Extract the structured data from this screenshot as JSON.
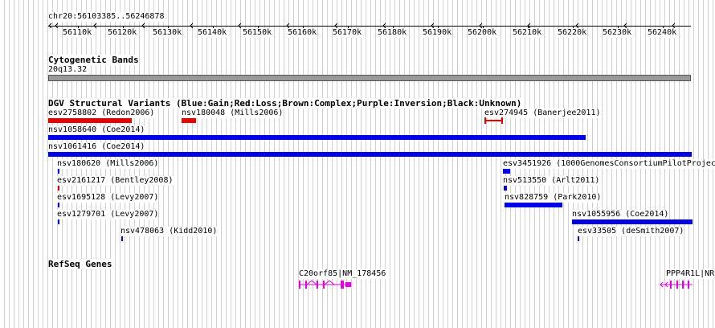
{
  "position": "chr20:56103385..56246878",
  "ruler_ticks": [
    "56110k",
    "56120k",
    "56130k",
    "56140k",
    "56150k",
    "56160k",
    "56170k",
    "56180k",
    "56190k",
    "56200k",
    "56210k",
    "56220k",
    "56230k",
    "56240k"
  ],
  "cyto": {
    "title": "Cytogenetic Bands",
    "band": "20q13.32"
  },
  "dgv": {
    "title": "DGV Structural Variants (Blue:Gain;Red:Loss;Brown:Complex;Purple:Inversion;Black:Unknown)",
    "variants": [
      "esv2758802 (Redon2006)",
      "nsv180048 (Mills2006)",
      "esv274945 (Banerjee2011)",
      "nsv1058640 (Coe2014)",
      "nsv1061416 (Coe2014)",
      "nsv180620 (Mills2006)",
      "esv3451926 (1000GenomesConsortiumPilotProjec",
      "esv2161217 (Bentley2008)",
      "nsv513550 (Arlt2011)",
      "esv1695128 (Levy2007)",
      "nsv828759 (Park2010)",
      "esv1279701 (Levy2007)",
      "nsv1055956 (Coe2014)",
      "nsv478063 (Kidd2010)",
      "esv33505 (deSmith2007)"
    ]
  },
  "refseq": {
    "title": "RefSeq Genes",
    "genes": [
      "C20orf85|NM_178456",
      "PPP4R1L|NR_"
    ]
  },
  "colors": {
    "gain": "#0000e6",
    "loss": "#e60000",
    "gene": "#e000e0",
    "grid": "#b7dce8"
  }
}
